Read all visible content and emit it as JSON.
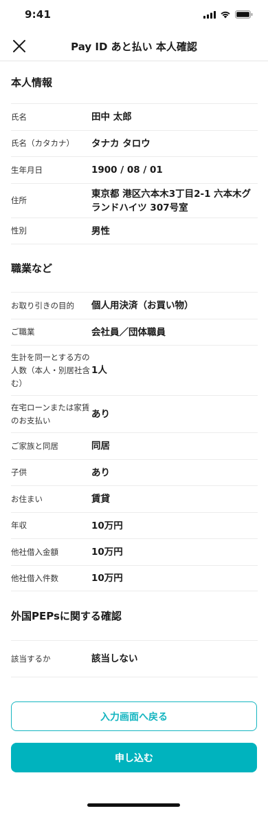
{
  "status_bar": {
    "time": "9:41"
  },
  "nav": {
    "title": "Pay ID あと払い 本人確認"
  },
  "sections": [
    {
      "title": "本人情報",
      "rows": [
        {
          "label": "氏名",
          "value": "田中 太郎"
        },
        {
          "label": "氏名（カタカナ）",
          "value": "タナカ タロウ"
        },
        {
          "label": "生年月日",
          "value": "1900 / 08 / 01"
        },
        {
          "label": "住所",
          "value": "東京都 港区六本木3丁目2-1 六本木グランドハイツ 307号室"
        },
        {
          "label": "性別",
          "value": "男性"
        }
      ]
    },
    {
      "title": "職業など",
      "rows": [
        {
          "label": "お取り引きの目的",
          "value": "個人用決済（お買い物）"
        },
        {
          "label": "ご職業",
          "value": "会社員／団体職員"
        },
        {
          "label": "生計を同一とする方の人数（本人・別居社含む）",
          "value": "1人"
        },
        {
          "label": "在宅ローンまたは家賃のお支払い",
          "value": "あり"
        },
        {
          "label": "ご家族と同居",
          "value": "同居"
        },
        {
          "label": "子供",
          "value": "あり"
        },
        {
          "label": "お住まい",
          "value": "賃貸"
        },
        {
          "label": "年収",
          "value": "10万円"
        },
        {
          "label": "他社借入金額",
          "value": "10万円"
        },
        {
          "label": "他社借入件数",
          "value": "10万円"
        }
      ]
    },
    {
      "title": "外国PEPsに関する確認",
      "rows": [
        {
          "label": "該当するか",
          "value": "該当しない"
        }
      ]
    }
  ],
  "buttons": {
    "back_label": "入力画面へ戻る",
    "submit_label": "申し込む"
  },
  "colors": {
    "accent": "#00b3be"
  },
  "icons": {
    "close": "close-icon",
    "signal": "cellular-signal-icon",
    "wifi": "wifi-icon",
    "battery": "battery-icon"
  }
}
